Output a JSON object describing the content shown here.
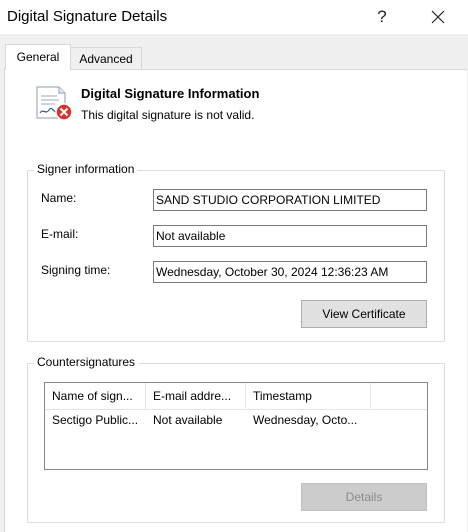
{
  "window": {
    "title": "Digital Signature Details",
    "help_glyph": "?"
  },
  "tabs": [
    {
      "label": "General",
      "selected": true
    },
    {
      "label": "Advanced",
      "selected": false
    }
  ],
  "info": {
    "icon": "certificate-invalid-icon",
    "title": "Digital Signature Information",
    "status": "This digital signature is not valid."
  },
  "signer": {
    "legend": "Signer information",
    "name_label": "Name:",
    "name_value": "SAND STUDIO CORPORATION LIMITED",
    "email_label": "E-mail:",
    "email_value": "Not available",
    "time_label": "Signing time:",
    "time_value": "Wednesday, October 30, 2024 12:36:23 AM",
    "view_cert_label": "View Certificate"
  },
  "countersignatures": {
    "legend": "Countersignatures",
    "columns": [
      "Name of sign...",
      "E-mail addre...",
      "Timestamp"
    ],
    "rows": [
      [
        "Sectigo Public...",
        "Not available",
        "Wednesday, Octo..."
      ]
    ],
    "details_label": "Details"
  }
}
